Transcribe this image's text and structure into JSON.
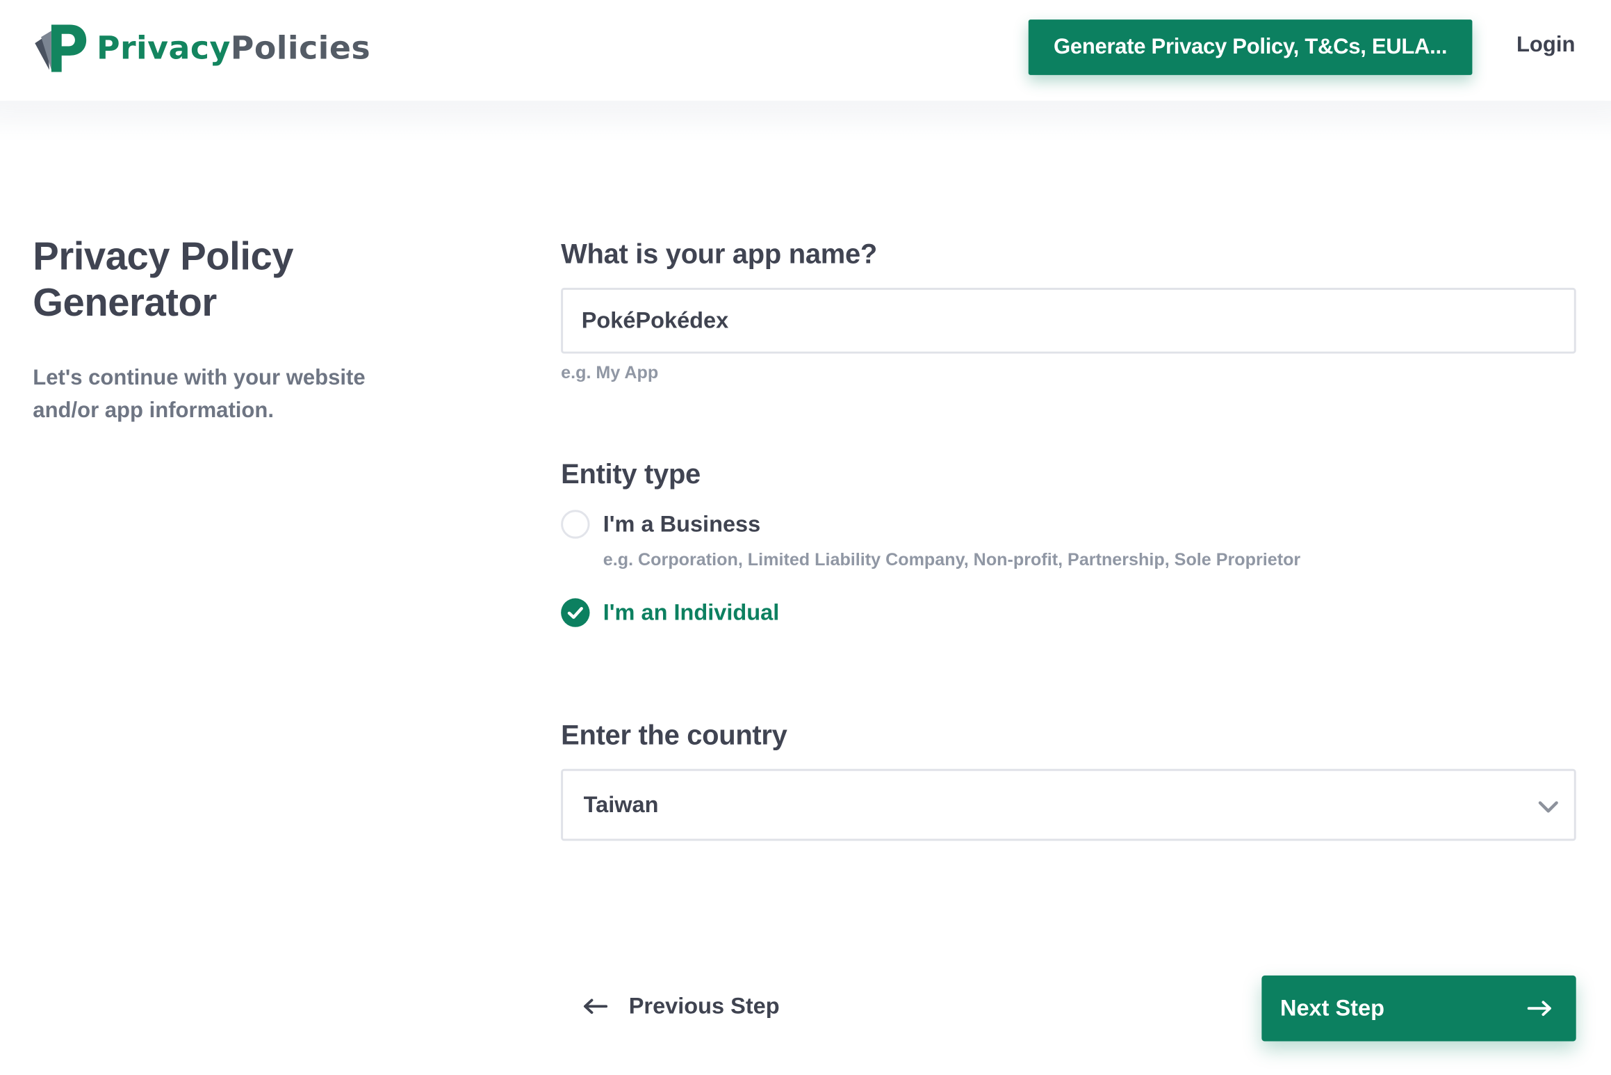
{
  "brand": {
    "name_part1": "Privacy",
    "name_part2": "Policies",
    "logo_letter": "P",
    "color_primary": "#0c8060",
    "color_logo_green": "#13855f",
    "color_logo_gray": "#545c66"
  },
  "header": {
    "cta_label": "Generate Privacy Policy, T&Cs, EULA...",
    "login_label": "Login"
  },
  "intro": {
    "title": "Privacy Policy Generator",
    "subtitle": "Let's continue with your website and/or app information."
  },
  "form": {
    "app_name": {
      "label": "What is your app name?",
      "value": "PokéPokédex",
      "hint": "e.g. My App"
    },
    "entity_type": {
      "label": "Entity type",
      "options": [
        {
          "label": "I'm a Business",
          "hint": "e.g. Corporation, Limited Liability Company, Non-profit, Partnership, Sole Proprietor",
          "selected": false
        },
        {
          "label": "I'm an Individual",
          "selected": true
        }
      ]
    },
    "country": {
      "label": "Enter the country",
      "selected": "Taiwan",
      "icon": "chevron-down-icon"
    }
  },
  "nav": {
    "previous_label": "Previous Step",
    "next_label": "Next Step",
    "previous_icon": "arrow-left-icon",
    "next_icon": "arrow-right-icon"
  }
}
